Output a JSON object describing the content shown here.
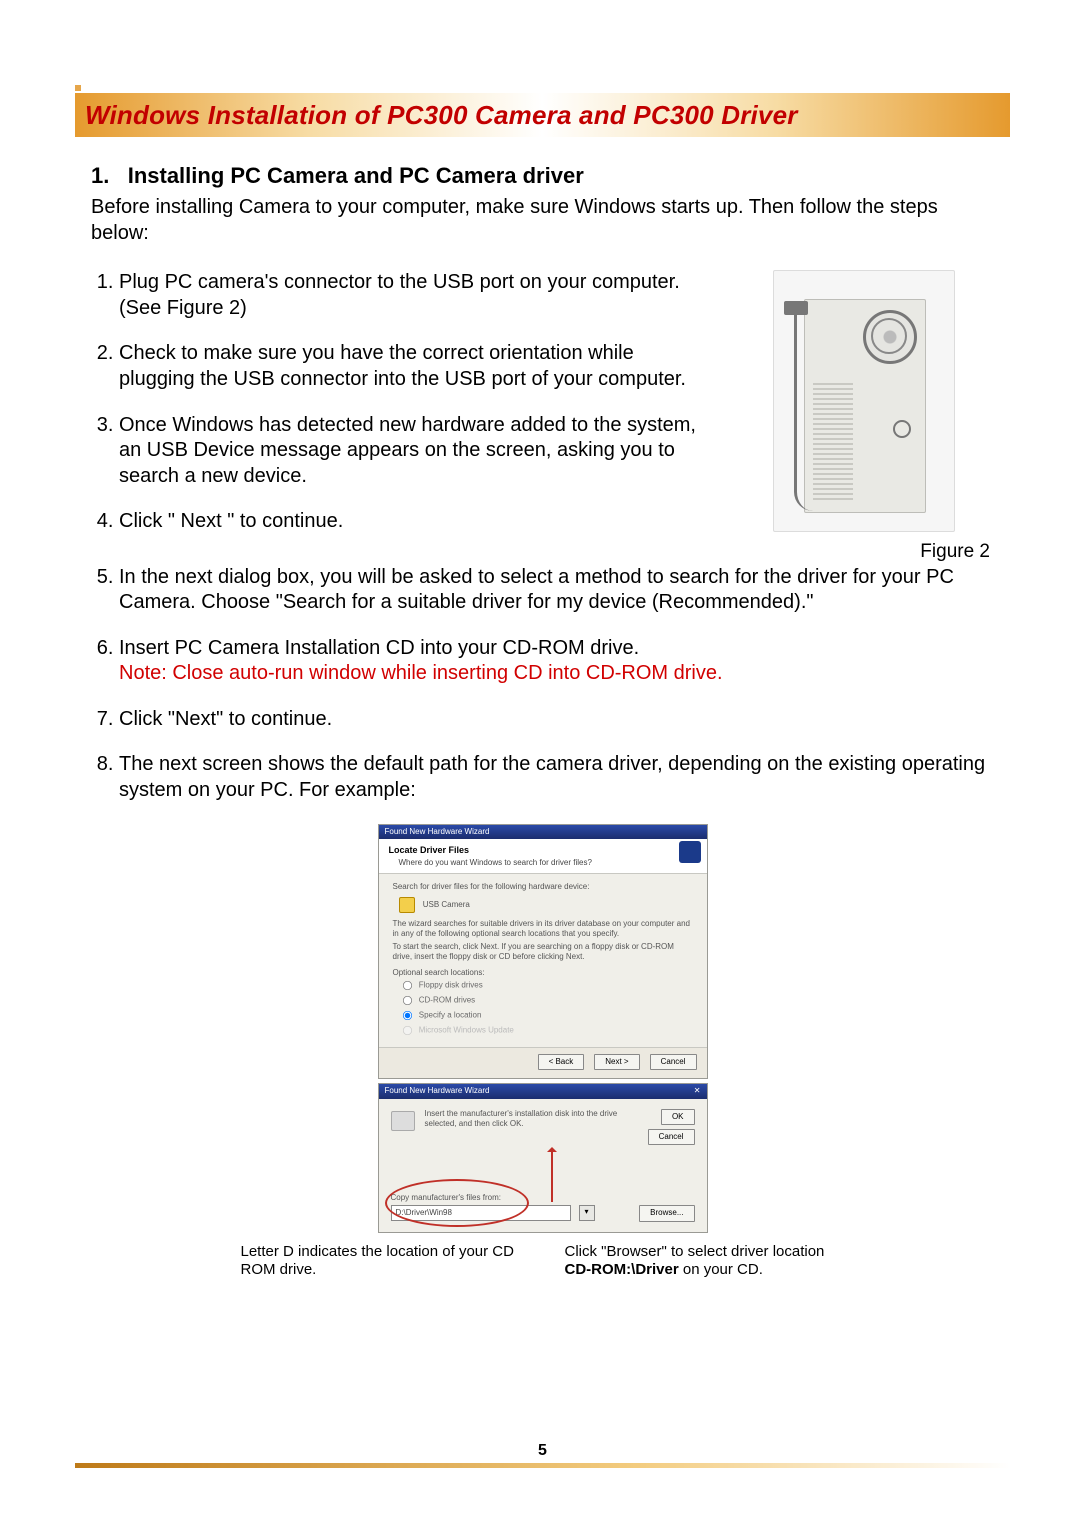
{
  "title": "Windows Installation of PC300 Camera and PC300 Driver",
  "section": {
    "number": "1.",
    "heading": "Installing PC Camera and PC Camera driver",
    "intro": "Before installing Camera to your computer, make sure Windows starts up. Then follow the steps below:"
  },
  "figure": {
    "label": "Figure 2"
  },
  "steps": {
    "s1": "Plug PC camera's connector to the USB port on your computer. (See Figure 2)",
    "s2": "Check to make sure you have the correct orientation while plugging the USB connector into the USB port of your computer.",
    "s3": "Once Windows has detected new hardware added to the system, an USB Device message appears on the screen, asking you to search a new device.",
    "s4": "Click \" Next \" to continue.",
    "s5": "In the next dialog box, you will be asked to select a method to search for the driver for your PC Camera. Choose \"Search for a suitable driver for my device (Recommended).\"",
    "s6a": "Insert PC Camera Installation CD into your CD-ROM drive.",
    "s6b": "Note: Close auto-run window while inserting CD into CD-ROM drive.",
    "s7": "Click \"Next\" to continue.",
    "s8": "The next screen shows the default path for the camera driver, depending on the existing operating system on your PC. For example:"
  },
  "wizard1": {
    "bar": "Found New Hardware Wizard",
    "header": "Locate Driver Files",
    "sub": "Where do you want Windows to search for driver files?",
    "line1": "Search for driver files for the following hardware device:",
    "device": "USB Camera",
    "line2": "The wizard searches for suitable drivers in its driver database on your computer and in any of the following optional search locations that you specify.",
    "line3": "To start the search, click Next. If you are searching on a floppy disk or CD-ROM drive, insert the floppy disk or CD before clicking Next.",
    "optsLabel": "Optional search locations:",
    "opt1": "Floppy disk drives",
    "opt2": "CD-ROM drives",
    "opt3": "Specify a location",
    "opt4": "Microsoft Windows Update",
    "btnBack": "< Back",
    "btnNext": "Next >",
    "btnCancel": "Cancel"
  },
  "wizard2": {
    "bar": "Found New Hardware Wizard",
    "msg": "Insert the manufacturer's installation disk into the drive selected, and then click OK.",
    "ok": "OK",
    "cancel": "Cancel",
    "pathLabel": "Copy manufacturer's files from:",
    "path": "D:\\Driver\\Win98",
    "browse": "Browse..."
  },
  "captions": {
    "left": "Letter D indicates the location of your CD ROM drive.",
    "rightA": "Click \"Browser\" to select driver location",
    "rightB_prefix": "CD-ROM:\\Driver",
    "rightB_suffix": " on your CD."
  },
  "pageNumber": "5"
}
